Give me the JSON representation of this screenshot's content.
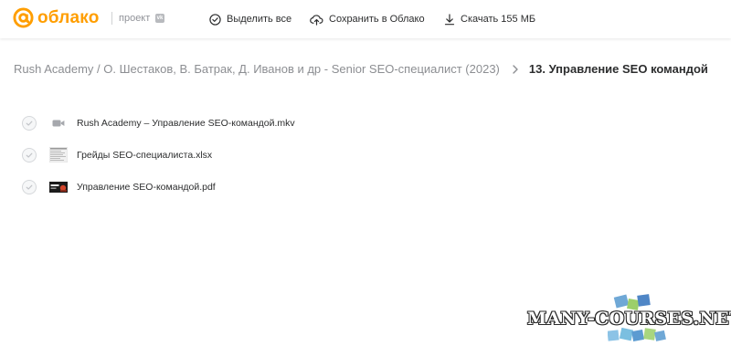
{
  "header": {
    "logo_text": "облако",
    "project_label": "проект",
    "vk_badge": "vk",
    "actions": {
      "select_all": "Выделить все",
      "save_to_cloud": "Сохранить в Облако",
      "download": "Скачать 155 МБ"
    },
    "icons": {
      "select_all": "check-circle-icon",
      "save_to_cloud": "cloud-upload-icon",
      "download": "download-icon"
    }
  },
  "breadcrumb": {
    "parent": "Rush Academy / О. Шестаков, В. Батрак, Д. Иванов и др - Senior SEO-специалист (2023)",
    "current": "13. Управление SEO командой"
  },
  "files": [
    {
      "name": "Rush Academy – Управление SEO-командой.mkv",
      "type": "video"
    },
    {
      "name": "Грейды SEO-специалиста.xlsx",
      "type": "spreadsheet"
    },
    {
      "name": "Управление SEO-командой.pdf",
      "type": "pdf"
    }
  ],
  "watermark": {
    "text": "MANY-COURSES.NET"
  },
  "colors": {
    "brand": "#ff9e00",
    "text_primary": "#2c2d2e",
    "text_secondary": "#8c8e92"
  }
}
